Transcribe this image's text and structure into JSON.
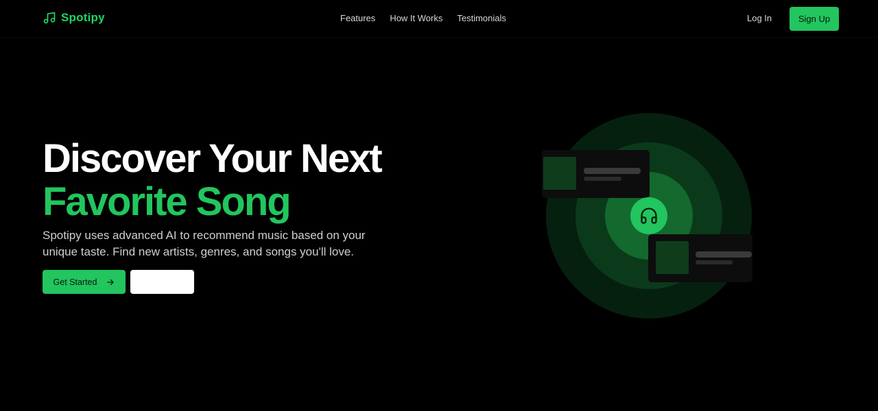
{
  "brand": {
    "name": "Spotipy",
    "icon": "music-note-icon",
    "color": "#1ed760"
  },
  "nav": {
    "links": [
      {
        "label": "Features"
      },
      {
        "label": "How It Works"
      },
      {
        "label": "Testimonials"
      }
    ],
    "login_label": "Log In",
    "signup_label": "Sign Up"
  },
  "hero": {
    "title_line1": "Discover Your Next",
    "title_line2": "Favorite Song",
    "description": "Spotipy uses advanced AI to recommend music based on your unique taste. Find new artists, genres, and songs you'll love.",
    "cta_primary": "Get Started",
    "cta_primary_icon": "arrow-right-icon",
    "cta_secondary": ""
  },
  "illustration": {
    "center_icon": "headphones-icon"
  },
  "colors": {
    "accent": "#22c55e",
    "background": "#000000"
  }
}
